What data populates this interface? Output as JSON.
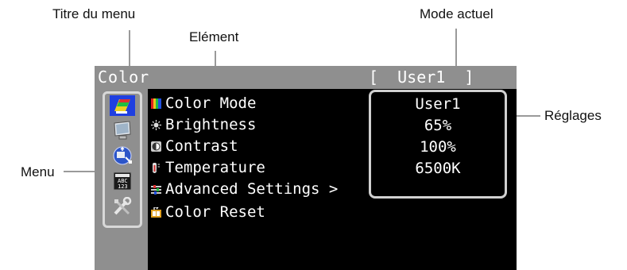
{
  "annotations": {
    "menu_title": "Titre du menu",
    "element": "Elément",
    "current_mode": "Mode actuel",
    "settings": "Réglages",
    "menu": "Menu"
  },
  "osd": {
    "title": "Color",
    "mode_display": "[  User1  ]",
    "side_icons": [
      "color-icon",
      "screen-icon",
      "display-arrows-icon",
      "abc-123-icon",
      "tools-icon"
    ],
    "items": [
      {
        "label": "Color Mode",
        "value": "User1",
        "icon": "color-mode-icon"
      },
      {
        "label": "Brightness",
        "value": "65%",
        "icon": "brightness-icon"
      },
      {
        "label": "Contrast",
        "value": "100%",
        "icon": "contrast-icon"
      },
      {
        "label": "Temperature",
        "value": "6500K",
        "icon": "temperature-icon"
      },
      {
        "label": "Advanced Settings >",
        "icon": "advanced-settings-icon"
      },
      {
        "label": "Color Reset",
        "icon": "color-reset-icon"
      }
    ],
    "colors": {
      "bar": "#8f8f8f",
      "panel": "#000000",
      "highlight": "#1f3fe0",
      "text": "#ffffff"
    }
  }
}
